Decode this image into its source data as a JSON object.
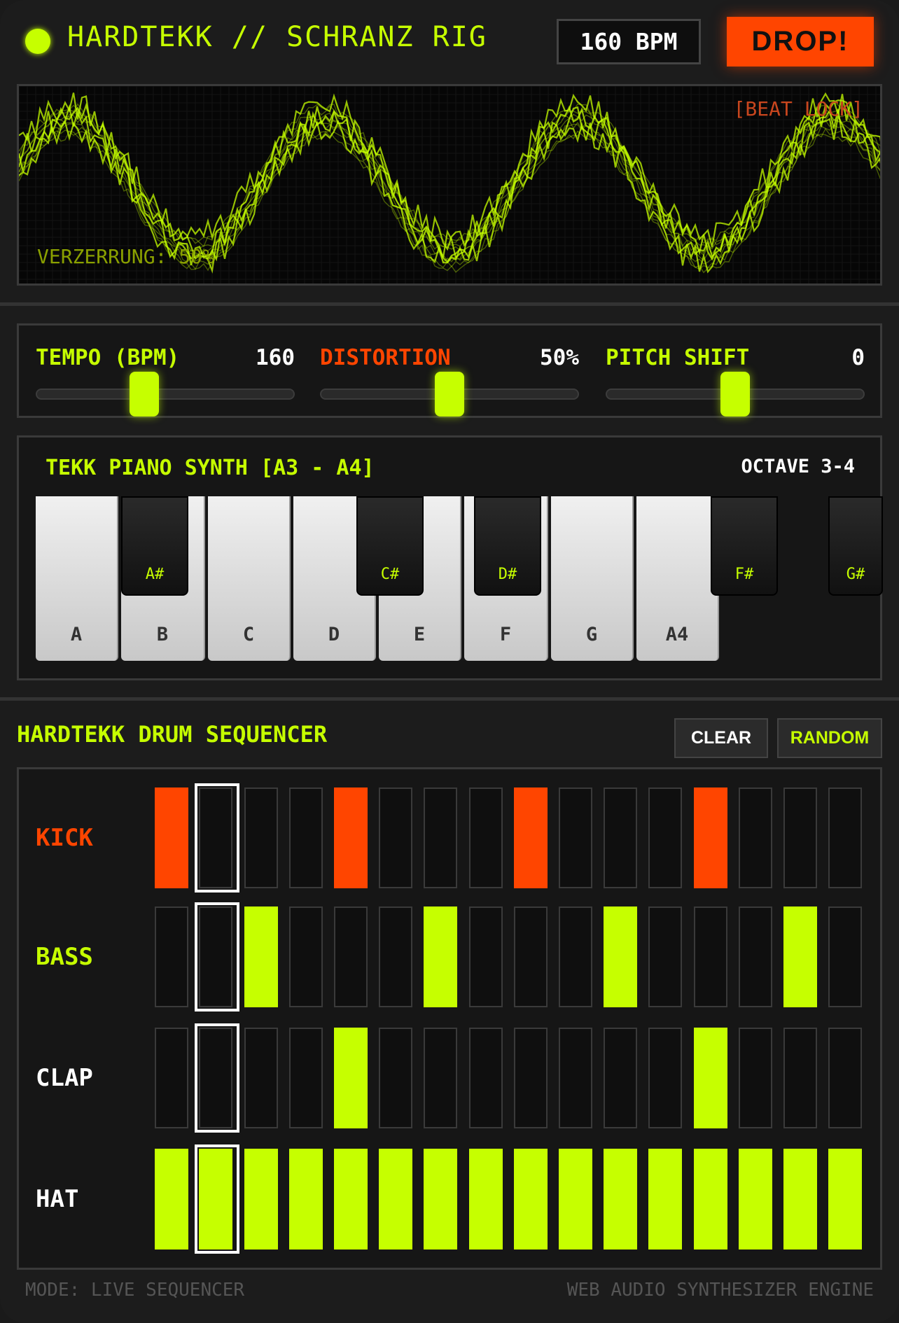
{
  "header": {
    "title": "HARDTEKK // SCHRANZ RIG",
    "bpm_display": "160 BPM",
    "drop_label": "DROP!"
  },
  "scope": {
    "beat_lock": "[BEAT LOCK]",
    "distortion_readout": "VERZERRUNG: 50%"
  },
  "sliders": [
    {
      "label": "TEMPO (BPM)",
      "value": "160",
      "level": 0.42,
      "label_color": "#c6ff00"
    },
    {
      "label": "DISTORTION",
      "value": "50%",
      "level": 0.5,
      "label_color": "#ff4500"
    },
    {
      "label": "PITCH SHIFT",
      "value": "0",
      "level": 0.5,
      "label_color": "#c6ff00"
    }
  ],
  "piano": {
    "title": "TEKK PIANO SYNTH [A3 - A4]",
    "octave": "OCTAVE 3-4",
    "white_keys": [
      "A",
      "B",
      "C",
      "D",
      "E",
      "F",
      "G",
      "A4"
    ],
    "black_keys": [
      "A#",
      "C#",
      "D#",
      "F#",
      "G#"
    ]
  },
  "sequencer": {
    "title": "HARDTEKK DRUM SEQUENCER",
    "clear_label": "CLEAR",
    "random_label": "RANDOM",
    "current_step": 1,
    "rows": [
      {
        "name": "KICK",
        "color": "#ff4500",
        "steps": [
          1,
          0,
          0,
          0,
          1,
          0,
          0,
          0,
          1,
          0,
          0,
          0,
          1,
          0,
          0,
          0
        ]
      },
      {
        "name": "BASS",
        "color": "#c6ff00",
        "steps": [
          0,
          0,
          1,
          0,
          0,
          0,
          1,
          0,
          0,
          0,
          1,
          0,
          0,
          0,
          1,
          0
        ]
      },
      {
        "name": "CLAP",
        "color": "#c6ff00",
        "steps": [
          0,
          0,
          0,
          0,
          1,
          0,
          0,
          0,
          0,
          0,
          0,
          0,
          1,
          0,
          0,
          0
        ]
      },
      {
        "name": "HAT",
        "color": "#c6ff00",
        "steps": [
          1,
          1,
          1,
          1,
          1,
          1,
          1,
          1,
          1,
          1,
          1,
          1,
          1,
          1,
          1,
          1
        ]
      }
    ]
  },
  "footer": {
    "mode": "MODE: LIVE SEQUENCER",
    "engine": "WEB AUDIO SYNTHESIZER ENGINE"
  },
  "colors": {
    "accent": "#c6ff00",
    "alert": "#ff4500",
    "background": "#1c1c1c"
  }
}
